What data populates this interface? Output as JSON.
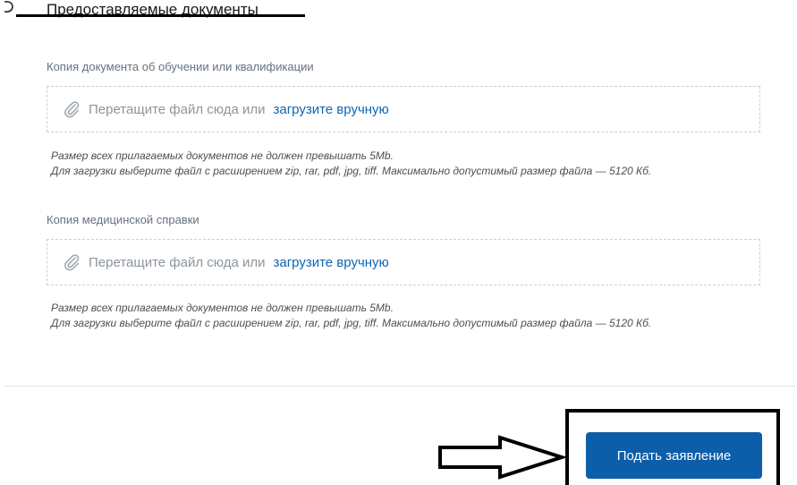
{
  "section": {
    "title": "Предоставляемые документы"
  },
  "documents": [
    {
      "label": "Копия документа об обучении или квалификации",
      "drop_text": "Перетащите файл сюда или",
      "upload_link": "загрузите вручную",
      "hint_line1": "Размер всех прилагаемых документов не должен превышать 5Mb.",
      "hint_line2": "Для загрузки выберите файл с расширением zip, rar, pdf, jpg, tiff. Максимально допустимый размер файла — 5120 Кб."
    },
    {
      "label": "Копия медицинской справки",
      "drop_text": "Перетащите файл сюда или",
      "upload_link": "загрузите вручную",
      "hint_line1": "Размер всех прилагаемых документов не должен превышать 5Mb.",
      "hint_line2": "Для загрузки выберите файл с расширением zip, rar, pdf, jpg, tiff. Максимально допустимый размер файла — 5120 Кб."
    }
  ],
  "actions": {
    "submit_label": "Подать заявление"
  },
  "icons": {
    "attachment": "paperclip-icon",
    "annotation_arrow": "arrow-right-icon"
  },
  "colors": {
    "link": "#0d66b3",
    "primary_button": "#0d5ea8",
    "dropzone_border": "#c9d0d6",
    "annotation": "#000000"
  }
}
